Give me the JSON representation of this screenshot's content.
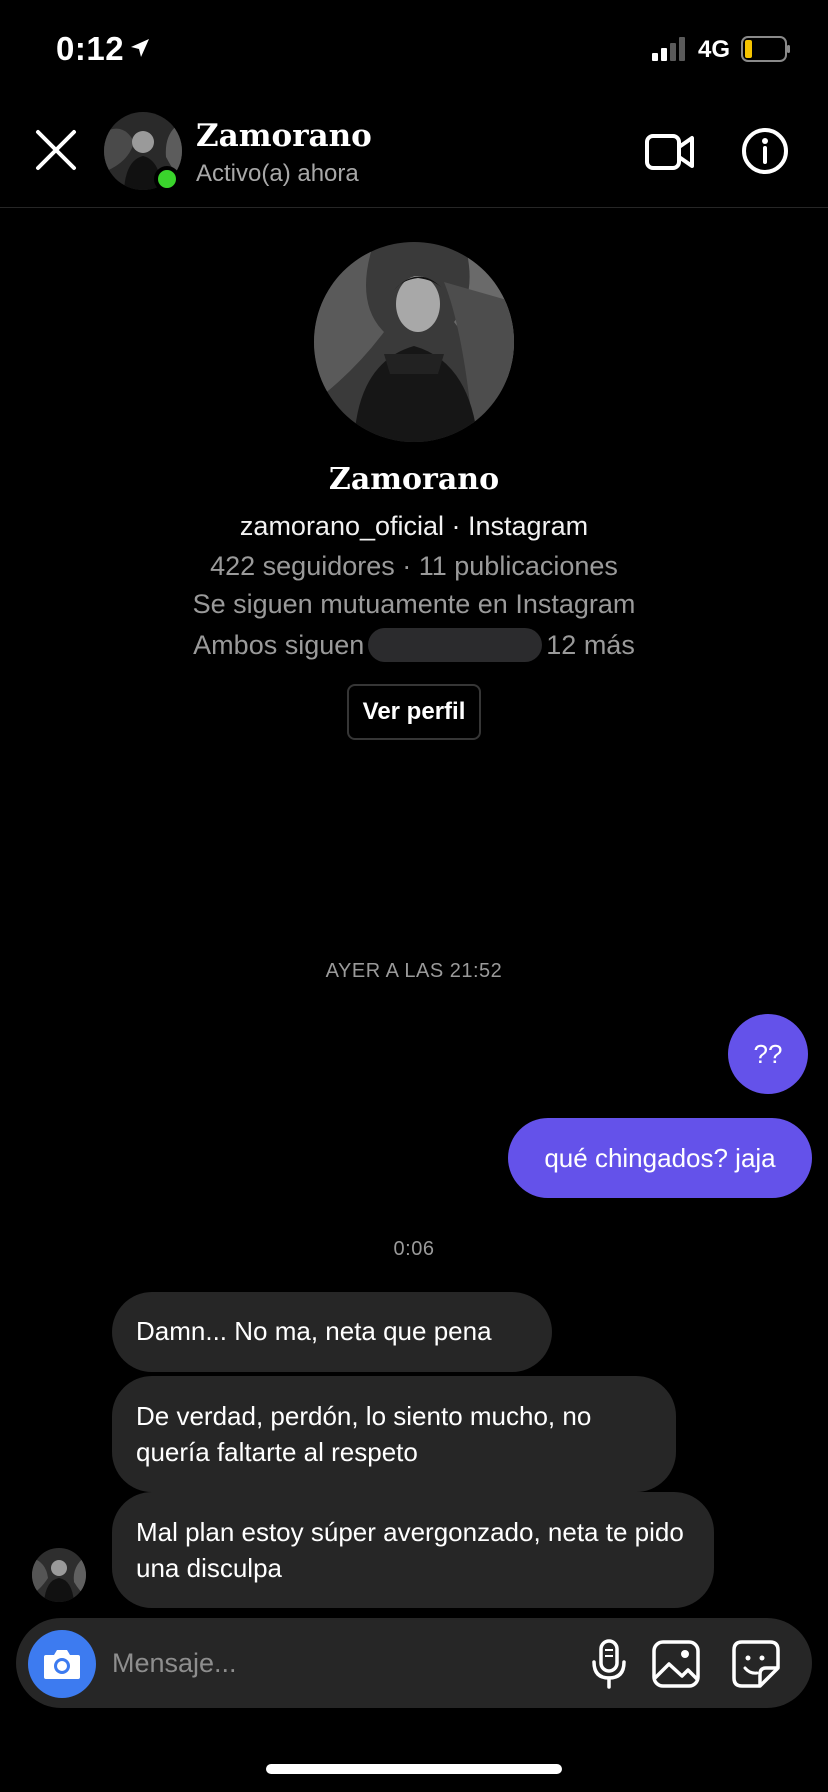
{
  "status_bar": {
    "time": "0:12",
    "network": "4G"
  },
  "header": {
    "name": "Zamorano",
    "status": "Activo(a) ahora"
  },
  "profile": {
    "name": "Zamorano",
    "handle_line": "zamorano_oficial · Instagram",
    "stats_line": "422 seguidores · 11 publicaciones",
    "mutual_line": "Se siguen mutuamente en Instagram",
    "followed_prefix": "Ambos siguen",
    "followed_suffix": "12 más",
    "view_profile_label": "Ver perfil"
  },
  "timestamps": [
    "AYER A LAS 21:52",
    "0:06"
  ],
  "messages": [
    {
      "from": "me",
      "text": "??"
    },
    {
      "from": "me",
      "text": "qué chingados? jaja"
    },
    {
      "from": "them",
      "text": "Damn... No ma, neta que pena"
    },
    {
      "from": "them",
      "text": "De verdad, perdón, lo siento mucho, no quería faltarte al respeto"
    },
    {
      "from": "them",
      "text": "Mal plan estoy súper avergonzado, neta te pido una disculpa"
    }
  ],
  "composer": {
    "placeholder": "Mensaje..."
  },
  "colors": {
    "sent_bubble": "#6452ea",
    "received_bubble": "#262626",
    "online": "#3ad42c",
    "camera_button": "#3d7bf0"
  },
  "icons": {
    "close": "close-icon",
    "video": "video-camera-icon",
    "info": "info-icon",
    "camera": "camera-icon",
    "mic": "microphone-icon",
    "gallery": "gallery-icon",
    "sticker": "sticker-icon"
  }
}
